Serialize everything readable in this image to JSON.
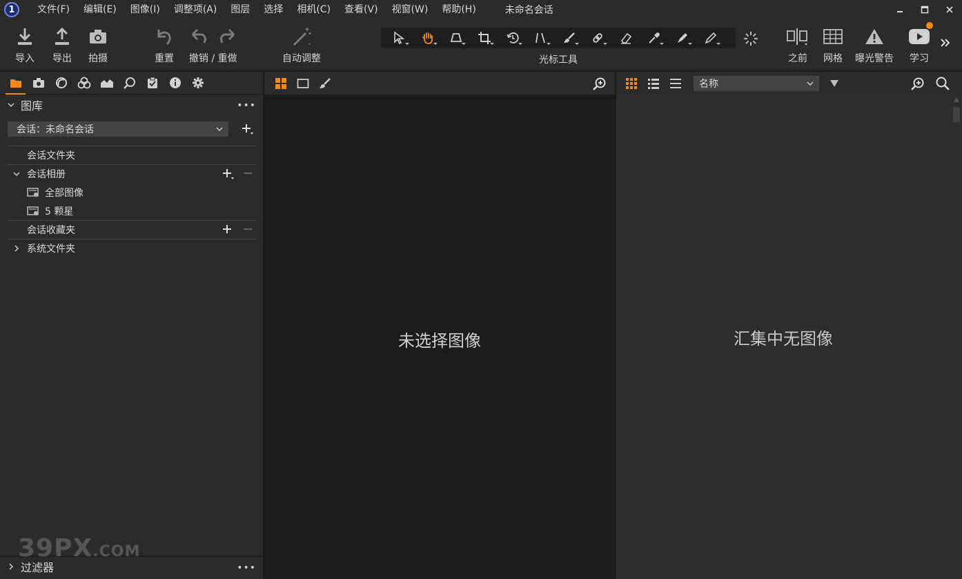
{
  "menu": {
    "logo": "1",
    "items": [
      "文件(F)",
      "编辑(E)",
      "图像(I)",
      "调整项(A)",
      "图层",
      "选择",
      "相机(C)",
      "查看(V)",
      "视窗(W)",
      "帮助(H)"
    ],
    "session_title": "未命名会话"
  },
  "toolbar": {
    "import": "导入",
    "export": "导出",
    "capture": "拍摄",
    "reset": "重置",
    "undo_redo": "撤销 / 重做",
    "auto_adjust": "自动调整",
    "cursor_tools": "光标工具",
    "before": "之前",
    "grid": "网格",
    "exposure_warning": "曝光警告",
    "learn": "学习"
  },
  "library": {
    "title": "图库",
    "session_select": "会话：未命名会话",
    "session_folders": "会话文件夹",
    "session_albums": "会话相册",
    "all_images": "全部图像",
    "five_stars": "5 颗星",
    "session_favorites": "会话收藏夹",
    "system_folders": "系统文件夹"
  },
  "filters": {
    "title": "过滤器"
  },
  "viewer": {
    "empty_message": "未选择图像"
  },
  "browser": {
    "sort_by": "名称",
    "empty_message": "汇集中无图像"
  },
  "watermark": {
    "main": "39PX",
    "suffix": ".COM"
  },
  "colors": {
    "accent": "#f08a1c",
    "panel": "#2b2b2b",
    "viewer": "#1b1b1b"
  }
}
